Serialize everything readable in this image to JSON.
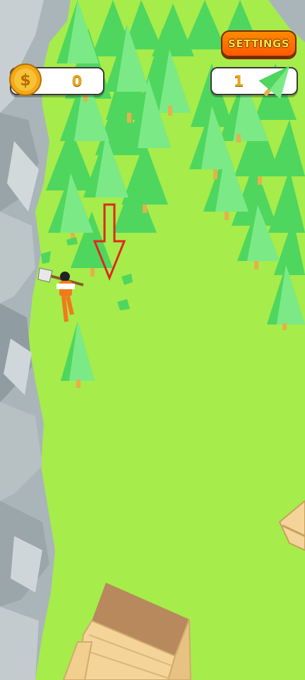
{
  "hud": {
    "coins": {
      "icon": "dollar-coin-icon",
      "value": "0"
    },
    "trees": {
      "icon": "pine-tree-icon",
      "value": "1"
    },
    "settings_label": "SETTINGS"
  },
  "scene": {
    "hint": {
      "icon": "arrow-down-icon",
      "color": "#e0281e"
    },
    "colors": {
      "grass": "#a6ec4a",
      "tree": "#5ee06a",
      "rock": "#aeb8bc",
      "plank": "#f5d49a"
    }
  }
}
